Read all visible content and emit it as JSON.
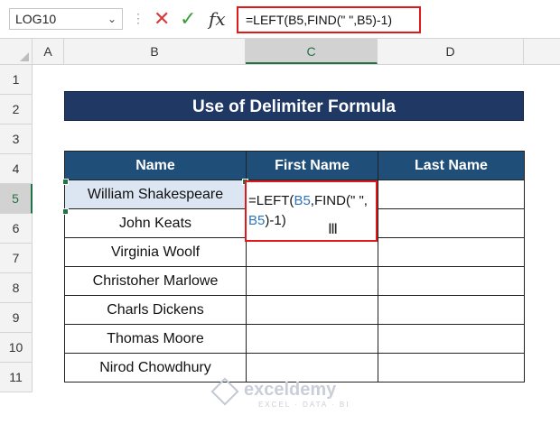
{
  "formula_bar": {
    "name_box": "LOG10",
    "fx": "fx",
    "formula": "=LEFT(B5,FIND(\" \",B5)-1)"
  },
  "columns": [
    "A",
    "B",
    "C",
    "D"
  ],
  "rows": [
    "1",
    "2",
    "3",
    "4",
    "5",
    "6",
    "7",
    "8",
    "9",
    "10",
    "11"
  ],
  "sheet": {
    "title": "Use of Delimiter Formula",
    "headers": {
      "name": "Name",
      "first": "First Name",
      "last": "Last Name"
    },
    "names": [
      "William Shakespeare",
      "John Keats",
      "Virginia Woolf",
      "Christoher Marlowe",
      "Charls Dickens",
      "Thomas Moore",
      "Nirod Chowdhury"
    ],
    "edit": {
      "part1": "=LEFT(",
      "ref1": "B5",
      "part2": ",FIND(\" \",",
      "ref2": "B5",
      "part3": ")-1)"
    }
  },
  "watermark": {
    "name": "exceldemy",
    "tagline": "EXCEL · DATA · BI"
  },
  "colors": {
    "title_bg": "#1f3864",
    "header_bg": "#1f4e79",
    "highlight": "#e01a1a",
    "ref": "#2e75b6"
  }
}
